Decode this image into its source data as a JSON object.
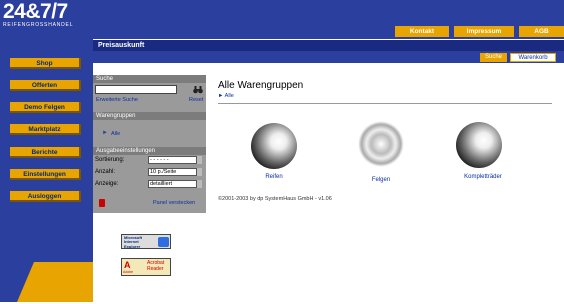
{
  "header": {
    "logo": "24&7/7",
    "logo_sub": "REIFENGROSSHANDEL",
    "links": [
      "Kontakt",
      "Impressum",
      "AGB"
    ],
    "section_title": "Preisauskunft"
  },
  "tabs": [
    "Suche",
    "Warenkorb"
  ],
  "nav": [
    "Shop",
    "Offerten",
    "Demo Felgen",
    "Marktplatz",
    "Berichte",
    "Einstellungen",
    "Ausloggen"
  ],
  "search": {
    "title": "Suche",
    "value": "",
    "advanced": "Erweiterte Suche",
    "reset": "Reset"
  },
  "groups": {
    "title": "Warengruppen",
    "all": "Alle"
  },
  "settings": {
    "title": "Ausgabeeinstellungen",
    "sort_label": "Sortierung:",
    "sort_value": "- - - - - -",
    "count_label": "Anzahl:",
    "count_value": "10 p./Seite",
    "view_label": "Anzeige:",
    "view_value": "detailliert",
    "hide_panel": "Panel verstecken"
  },
  "main": {
    "title": "Alle Warengruppen",
    "breadcrumb": "Alle",
    "items": [
      "Reifen",
      "Felgen",
      "Kompletträder"
    ],
    "copyright": "©2001-2003 by dp SystemHaus GmbH - v1.06"
  },
  "badges": {
    "ie_line1": "Microsoft",
    "ie_line2": "Internet",
    "ie_line3": "Explorer",
    "adobe": "Adobe",
    "acrobat_line1": "Acrobat",
    "acrobat_line2": "Reader"
  },
  "colors": {
    "blue": "#2b3f9e",
    "gold": "#e8a400",
    "panel_gray": "#9a9a9a"
  }
}
